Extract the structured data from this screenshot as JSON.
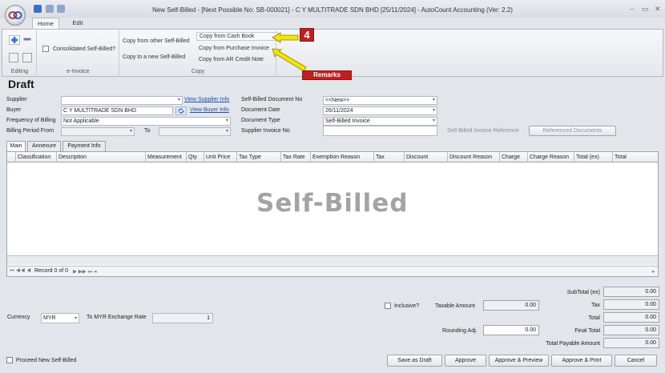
{
  "window": {
    "title": "New Self-Billed - [Next Possible No: SB-000021] - C Y MULTITRADE SDN BHD [25/11/2024] - AutoCount Accounting (Ver: 2.2)",
    "minimize": "–",
    "maximize": "▭",
    "close": "✕"
  },
  "ribbon_tabs": [
    "Home",
    "Edit"
  ],
  "ribbon": {
    "editing_label": "Editing",
    "einvoice": {
      "checkbox_label": "Consolidated Self-Billed?",
      "group_label": "e-Invoice"
    },
    "copy": {
      "from_other": "Copy from other Self-Billed",
      "to_new": "Copy to a new Self-Billed",
      "from_cash_book": "Copy from Cash Book",
      "from_purchase_invoice": "Copy from Purchase Invoice",
      "from_ar_credit_note": "Copy from AR Credit Note",
      "group_label": "Copy"
    }
  },
  "annotations": {
    "step_number": "4",
    "remarks_label": "Remarks",
    "color": "#c0201f",
    "arrow_color": "#f2e600"
  },
  "page_title": "Draft",
  "form": {
    "supplier_label": "Supplier",
    "supplier_value": "",
    "view_supplier_info": "View Supplier Info",
    "buyer_label": "Buyer",
    "buyer_value": "C Y MULTITRADE SDN BHD",
    "view_buyer_info": "View Buyer Info",
    "frequency_label": "Frequency of Billing",
    "frequency_value": "Not Applicable",
    "billing_period_label": "Billing Period From",
    "to_label": "To",
    "doc_no_label": "Self-Billed Document No",
    "doc_no_value": "<<New>>",
    "doc_date_label": "Document Date",
    "doc_date_value": "26/11/2024",
    "doc_type_label": "Document Type",
    "doc_type_value": "Self-Billed Invoice",
    "supplier_invoice_label": "Supplier Invoice No",
    "reference_label": "Self-Billed Invoice Reference",
    "referenced_documents": "Referenced Documents"
  },
  "form_tabs": [
    "Main",
    "Annexure",
    "Payment Info"
  ],
  "grid": {
    "columns": [
      "Classification",
      "Description",
      "Measurement",
      "Qty",
      "Unit Price",
      "Tax Type",
      "Tax Rate",
      "Exemption Reason",
      "Tax",
      "Discount",
      "Discount Reason",
      "Charge",
      "Charge Reason",
      "Total (ex)",
      "Total"
    ],
    "watermark": "Self-Billed",
    "navigator": "Record 0 of 0"
  },
  "footer": {
    "currency_label": "Currency",
    "currency_value": "MYR",
    "exchange_rate_label": "To MYR Exchange Rate",
    "exchange_rate_value": "1",
    "inclusive_label": "Inclusive?",
    "taxable_amount_label": "Taxable Amount",
    "taxable_amount_value": "0.00",
    "rounding_label": "Rounding Adj.",
    "rounding_value": "0.00",
    "proceed_new_label": "Proceed New Self-Billed"
  },
  "totals": {
    "subtotal_label": "SubTotal (ex)",
    "subtotal_value": "0.00",
    "tax_label": "Tax",
    "tax_value": "0.00",
    "total_label": "Total",
    "total_value": "0.00",
    "final_total_label": "Final Total",
    "final_total_value": "0.00",
    "total_payable_label": "Total Payable Amount",
    "total_payable_value": "0.00"
  },
  "buttons": {
    "save_as_draft": "Save as Draft",
    "approve": "Approve",
    "approve_preview": "Approve & Preview",
    "approve_print": "Approve & Print",
    "cancel": "Cancel"
  }
}
